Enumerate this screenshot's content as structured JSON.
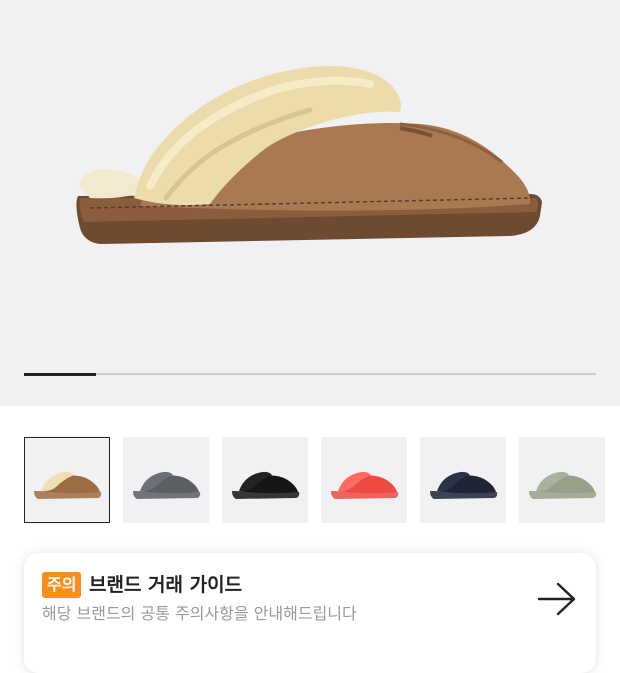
{
  "product": {
    "main_image": "brown-sheepskin-slipper",
    "gallery": {
      "progress_fraction": 0.125
    },
    "thumbnails": [
      {
        "name": "chestnut",
        "color": "#9d6c43",
        "fur": "#eedfb7",
        "selected": true
      },
      {
        "name": "grey",
        "color": "#5b5f64",
        "fur": "#6d7177",
        "selected": false
      },
      {
        "name": "black",
        "color": "#161616",
        "fur": "#222222",
        "selected": false
      },
      {
        "name": "coral",
        "color": "#ee4a44",
        "fur": "#ff6b5f",
        "selected": false
      },
      {
        "name": "navy",
        "color": "#1f2437",
        "fur": "#2c3247",
        "selected": false
      },
      {
        "name": "sage",
        "color": "#97a18a",
        "fur": "#a9b29c",
        "selected": false
      }
    ]
  },
  "brand_guide": {
    "badge": "주의",
    "title": "브랜드 거래 가이드",
    "subtitle": "해당 브랜드의 공통 주의사항을 안내해드립니다",
    "arrow_icon": "arrow-right-icon"
  },
  "colors": {
    "badge": "#f98d1e",
    "hero_background": "#f1f1f3"
  }
}
